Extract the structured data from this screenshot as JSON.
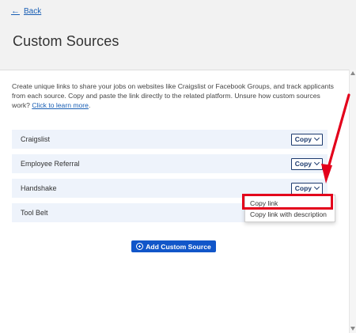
{
  "header": {
    "back_label": "Back",
    "title": "Custom Sources"
  },
  "description": {
    "text": "Create unique links to share your jobs on websites like Craigslist or Facebook Groups, and track applicants from each source. Copy and paste the link directly to the related platform. Unsure how custom sources work? ",
    "link_label": "Click to learn more",
    "suffix": "."
  },
  "sources": [
    {
      "name": "Craigslist",
      "copy_label": "Copy"
    },
    {
      "name": "Employee Referral",
      "copy_label": "Copy"
    },
    {
      "name": "Handshake",
      "copy_label": "Copy"
    },
    {
      "name": "Tool Belt",
      "copy_label": ""
    }
  ],
  "dropdown": {
    "items": [
      "Copy link",
      "Copy link with description"
    ]
  },
  "add_button": {
    "label": "Add Custom Source"
  },
  "colors": {
    "link": "#1a5fb4",
    "row_bg": "#eef3fb",
    "primary_button": "#1156c9",
    "highlight": "#e3001b"
  },
  "icons": {
    "back": "arrow-left-icon",
    "copy_dropdown": "chevron-down-icon",
    "add": "plus-circle-icon"
  }
}
